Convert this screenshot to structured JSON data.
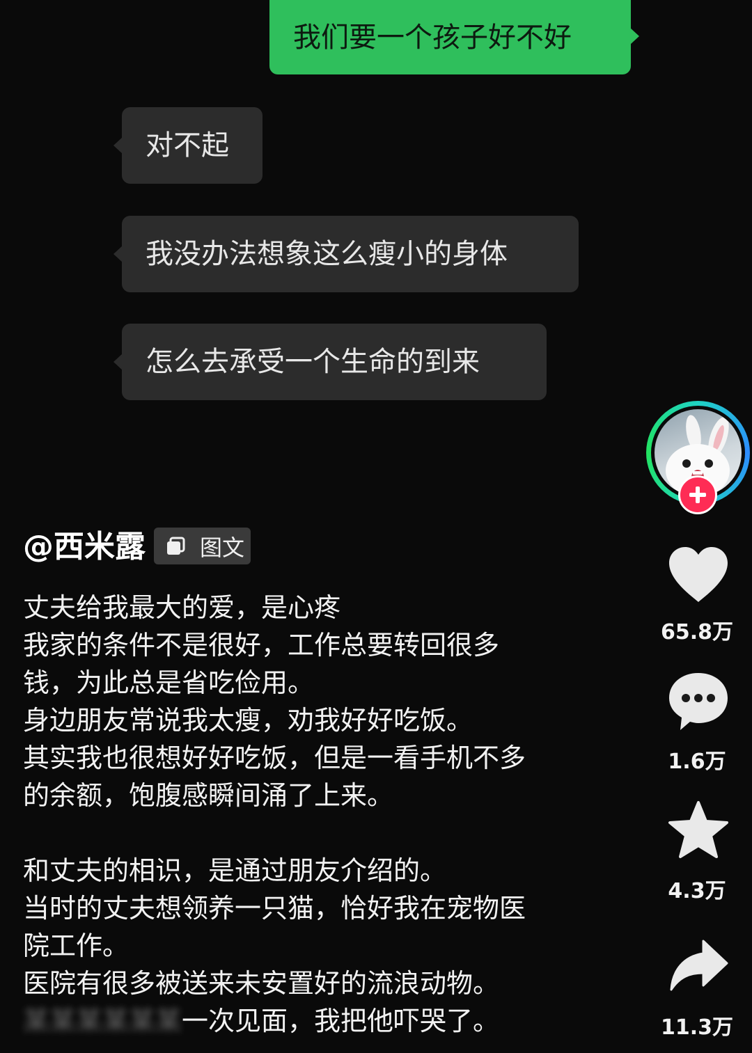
{
  "chat": {
    "sent_message": "我们要一个孩子好不好",
    "received_messages": [
      "对不起",
      "我没办法想象这么瘦小的身体",
      "怎么去承受一个生命的到来"
    ]
  },
  "actions": {
    "avatar_icon": "rabbit-avatar",
    "follow_icon": "plus-icon",
    "like": {
      "icon": "heart-icon",
      "count": "65.8万"
    },
    "comment": {
      "icon": "comment-icon",
      "count": "1.6万"
    },
    "favorite": {
      "icon": "star-icon",
      "count": "4.3万"
    },
    "share": {
      "icon": "share-arrow-icon",
      "count": "11.3万"
    }
  },
  "post": {
    "author": "@西米露",
    "tag_label": "图文",
    "caption_lines": [
      "丈夫给我最大的爱，是心疼",
      "我家的条件不是很好，工作总要转回很多",
      "钱，为此总是省吃俭用。",
      "身边朋友常说我太瘦，劝我好好吃饭。",
      "其实我也很想好好吃饭，但是一看手机不多",
      "的余额，饱腹感瞬间涌了上来。",
      "",
      "和丈夫的相识，是通过朋友介绍的。",
      "当时的丈夫想领养一只猫，恰好我在宠物医",
      "院工作。",
      "医院有很多被送来未安置好的流浪动物。"
    ],
    "last_line_visible": "一次见面，我把他吓哭了。"
  },
  "colors": {
    "background": "#0a0a0a",
    "sent_bubble": "#2fbf5c",
    "received_bubble": "#2c2c2c",
    "follow_button": "#fe2c55"
  }
}
